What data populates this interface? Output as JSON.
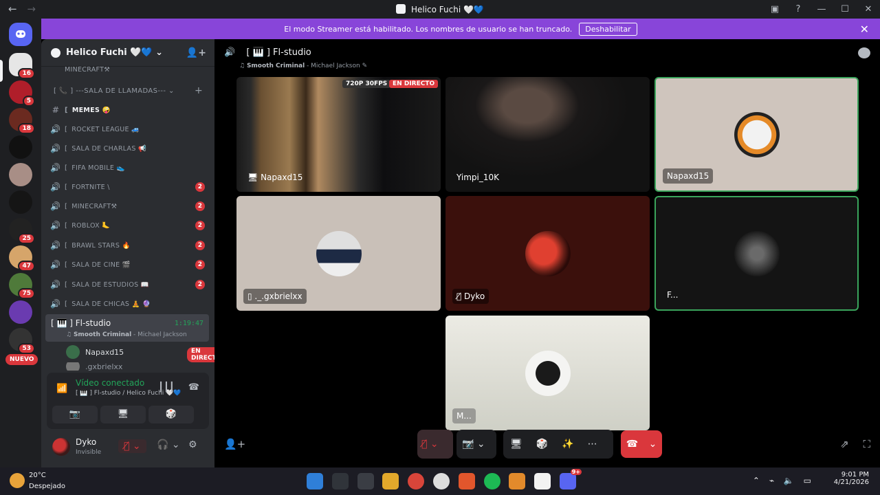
{
  "window": {
    "title": "Helico Fuchi 🤍💙",
    "back": "←",
    "forward": "→",
    "inbox_icon": "▣",
    "help_icon": "?",
    "minimize": "—",
    "maximize": "☐",
    "close": "✕"
  },
  "rail": {
    "badges": [
      "16",
      "5",
      "18",
      "25",
      "47",
      "75",
      "53"
    ],
    "new_label": "NUEVO"
  },
  "banner": {
    "text": "El modo Streamer está habilitado. Los nombres de usuario se han truncado.",
    "button": "Deshabilitar",
    "close": "✕"
  },
  "server": {
    "name": "Helico Fuchi 🤍💙 ⌄",
    "invite_icon": "👤+"
  },
  "sidebar": {
    "top_partial": "MINECRAFT⚒",
    "category": "[ 📞 ] ---SALA DE LLAMADAS--- ⌄",
    "category_plus": "+",
    "channels": [
      {
        "name": "MEMES 🤪",
        "icon": "#",
        "count": ""
      },
      {
        "name": "ROCKET LEAGUE 🚙",
        "icon": "🔊",
        "count": ""
      },
      {
        "name": "SALA DE CHARLAS 📢",
        "icon": "🔊",
        "count": ""
      },
      {
        "name": "FIFA MOBILE 👟",
        "icon": "🔊",
        "count": ""
      },
      {
        "name": "FORTNITE \\",
        "icon": "🔊",
        "count": "2"
      },
      {
        "name": "MINECRAFT⚒",
        "icon": "🔊",
        "count": "2"
      },
      {
        "name": "ROBLOX 🦶",
        "icon": "🔊",
        "count": "2"
      },
      {
        "name": "BRAWL STARS 🔥",
        "icon": "🔊",
        "count": "2"
      },
      {
        "name": "SALA DE CINE 🎬",
        "icon": "🔊",
        "count": "2"
      },
      {
        "name": "SALA DE ESTUDIOS 📖",
        "icon": "🔊",
        "count": "2"
      },
      {
        "name": "SALA DE CHICAS 🧘 🔮",
        "icon": "🔊",
        "count": ""
      }
    ],
    "active_channel": {
      "name": "[ 🎹 ] Fl-studio",
      "time": "1:19:47",
      "song_title": "Smooth Criminal",
      "song_artist": " - Michael Jackson"
    },
    "members": [
      {
        "name": "Napaxd15",
        "live": "EN DIRECTO"
      },
      {
        "name": ".gxbrielxx",
        "live": ""
      }
    ]
  },
  "voice": {
    "status": "Vídeo conectado",
    "channel": "[ 🎹 ] Fl-studio / Helico Fuchi 🤍💙",
    "buttons": [
      "📷",
      "🖥",
      "🎲",
      "✨"
    ]
  },
  "user": {
    "name": "Dyko",
    "status": "Invisible"
  },
  "stage": {
    "channel": "[ 🎹 ] Fl-studio",
    "song_title": "Smooth Criminal",
    "song_artist": " - Michael Jackson",
    "tiles": [
      {
        "label": "Napaxd15",
        "tag1": "720P 30FPS",
        "tag2": "EN DIRECTO"
      },
      {
        "label": "Yimpi_10K"
      },
      {
        "label": "Napaxd15"
      },
      {
        "label": "._.gxbrielxx"
      },
      {
        "label": "Dyko"
      },
      {
        "label": "F..."
      },
      {
        "label": "M..."
      }
    ]
  },
  "taskbar": {
    "temp": "20°C",
    "weather": "Despejado",
    "time": "9:01 PM",
    "date": "4/21/2026",
    "app_badge": "9+"
  }
}
